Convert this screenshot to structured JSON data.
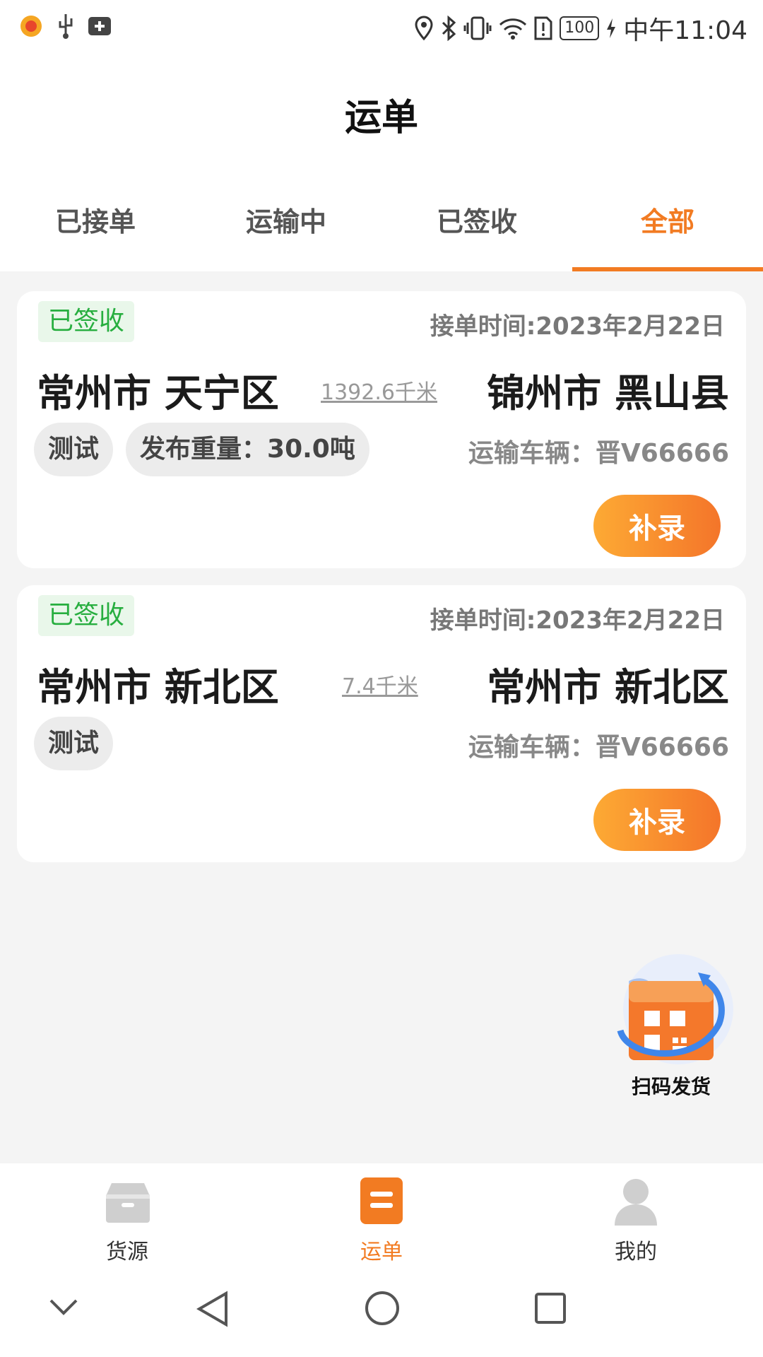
{
  "status_bar": {
    "battery": "100",
    "time": "中午11:04"
  },
  "header": {
    "title": "运单"
  },
  "tabs": [
    {
      "label": "已接单",
      "active": false
    },
    {
      "label": "运输中",
      "active": false
    },
    {
      "label": "已签收",
      "active": false
    },
    {
      "label": "全部",
      "active": true
    }
  ],
  "orders": [
    {
      "status": "已签收",
      "time": "接单时间:2023年2月22日",
      "from": "常州市 天宁区",
      "distance": "1392.6千米",
      "to": "锦州市 黑山县",
      "tags": [
        "测试",
        "发布重量：30.0吨"
      ],
      "vehicle_label": "运输车辆：",
      "vehicle": "晋V66666",
      "action": "补录"
    },
    {
      "status": "已签收",
      "time": "接单时间:2023年2月22日",
      "from": "常州市 新北区",
      "distance": "7.4千米",
      "to": "常州市 新北区",
      "tags": [
        "测试"
      ],
      "vehicle_label": "运输车辆：",
      "vehicle": "晋V66666",
      "action": "补录"
    }
  ],
  "scan": {
    "label": "扫码发货"
  },
  "bottom_nav": [
    {
      "label": "货源",
      "active": false
    },
    {
      "label": "运单",
      "active": true
    },
    {
      "label": "我的",
      "active": false
    }
  ],
  "colors": {
    "accent": "#f27b22",
    "status_green": "#27ae3f"
  }
}
